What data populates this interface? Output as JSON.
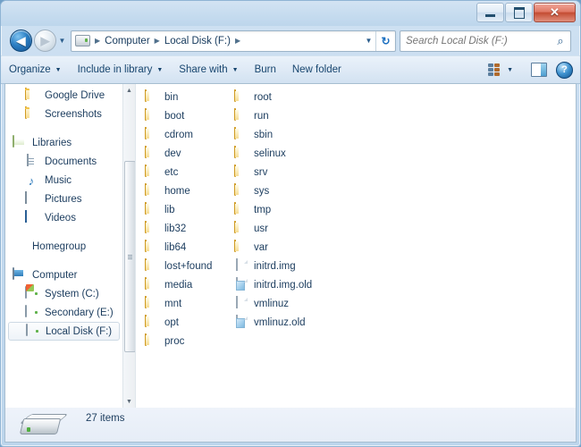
{
  "window": {
    "caption_buttons": {
      "minimize": "minimize-button",
      "maximize": "maximize-button",
      "close_label": "✕"
    }
  },
  "address_bar": {
    "back_glyph": "◀",
    "forward_glyph": "▶",
    "history_caret": "▼",
    "breadcrumb": [
      "Computer",
      "Local Disk (F:)"
    ],
    "separator": "▶",
    "dropdown_caret": "▼",
    "refresh_glyph": "↻"
  },
  "search": {
    "placeholder": "Search Local Disk (F:)",
    "value": "",
    "icon_glyph": "⌕"
  },
  "toolbar": {
    "items": [
      {
        "label": "Organize",
        "caret": true
      },
      {
        "label": "Include in library",
        "caret": true
      },
      {
        "label": "Share with",
        "caret": true
      },
      {
        "label": "Burn",
        "caret": false
      },
      {
        "label": "New folder",
        "caret": false
      }
    ],
    "caret_glyph": "▼",
    "views_caret": "▼",
    "help_label": "?"
  },
  "sidebar": {
    "items": [
      {
        "label": "Google Drive",
        "icon": "folder-icon",
        "type": "child"
      },
      {
        "label": "Screenshots",
        "icon": "folder-icon",
        "type": "child"
      },
      {
        "label": "",
        "icon": "",
        "type": "gap"
      },
      {
        "label": "Libraries",
        "icon": "library-icon",
        "type": "head"
      },
      {
        "label": "Documents",
        "icon": "document-icon",
        "type": "child"
      },
      {
        "label": "Music",
        "icon": "music-icon",
        "type": "child"
      },
      {
        "label": "Pictures",
        "icon": "picture-icon",
        "type": "child"
      },
      {
        "label": "Videos",
        "icon": "video-icon",
        "type": "child"
      },
      {
        "label": "",
        "icon": "",
        "type": "gap"
      },
      {
        "label": "Homegroup",
        "icon": "homegroup-icon",
        "type": "head"
      },
      {
        "label": "",
        "icon": "",
        "type": "gap"
      },
      {
        "label": "Computer",
        "icon": "computer-icon",
        "type": "head"
      },
      {
        "label": "System (C:)",
        "icon": "system-drive-icon",
        "type": "child"
      },
      {
        "label": "Secondary (E:)",
        "icon": "drive-icon",
        "type": "child"
      },
      {
        "label": "Local Disk (F:)",
        "icon": "drive-icon",
        "type": "selected"
      }
    ],
    "scroll_up_glyph": "▲",
    "scroll_down_glyph": "▼"
  },
  "files": [
    {
      "name": "bin",
      "kind": "folder"
    },
    {
      "name": "boot",
      "kind": "folder"
    },
    {
      "name": "cdrom",
      "kind": "folder"
    },
    {
      "name": "dev",
      "kind": "folder"
    },
    {
      "name": "etc",
      "kind": "folder"
    },
    {
      "name": "home",
      "kind": "folder"
    },
    {
      "name": "lib",
      "kind": "folder"
    },
    {
      "name": "lib32",
      "kind": "folder"
    },
    {
      "name": "lib64",
      "kind": "folder"
    },
    {
      "name": "lost+found",
      "kind": "folder"
    },
    {
      "name": "media",
      "kind": "folder"
    },
    {
      "name": "mnt",
      "kind": "folder"
    },
    {
      "name": "opt",
      "kind": "folder"
    },
    {
      "name": "proc",
      "kind": "folder"
    },
    {
      "name": "root",
      "kind": "folder"
    },
    {
      "name": "run",
      "kind": "folder"
    },
    {
      "name": "sbin",
      "kind": "folder"
    },
    {
      "name": "selinux",
      "kind": "folder"
    },
    {
      "name": "srv",
      "kind": "folder"
    },
    {
      "name": "sys",
      "kind": "folder"
    },
    {
      "name": "tmp",
      "kind": "folder"
    },
    {
      "name": "usr",
      "kind": "folder"
    },
    {
      "name": "var",
      "kind": "folder"
    },
    {
      "name": "initrd.img",
      "kind": "file"
    },
    {
      "name": "initrd.img.old",
      "kind": "file-old"
    },
    {
      "name": "vmlinuz",
      "kind": "file"
    },
    {
      "name": "vmlinuz.old",
      "kind": "file-old"
    }
  ],
  "status": {
    "item_count": "27 items"
  },
  "colors": {
    "text": "#1b3c5e",
    "toolbar_text": "#17456e",
    "folder": "#f0bd3e",
    "accent_blue": "#2b7fc4",
    "close_red": "#c44c33"
  }
}
